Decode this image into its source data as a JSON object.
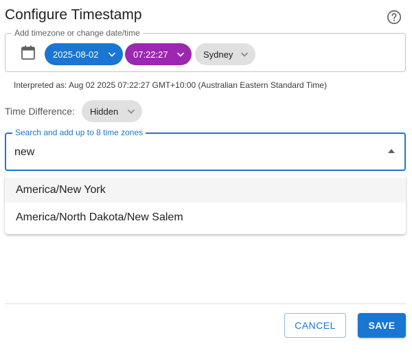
{
  "dialog": {
    "title": "Configure Timestamp",
    "help_icon": "help-circle-icon"
  },
  "timezone_group": {
    "legend": "Add timezone or change date/time",
    "calendar_icon": "calendar-icon",
    "date_chip": "2025-08-02",
    "time_chip": "07:22:27",
    "timezone_chip": "Sydney"
  },
  "interpreted": "Interpreted as: Aug 02 2025 07:22:27 GMT+10:00 (Australian Eastern Standard Time)",
  "time_difference": {
    "label": "Time Difference:",
    "value": "Hidden"
  },
  "search": {
    "legend": "Search and add up to 8 time zones",
    "value": "new"
  },
  "dropdown": {
    "options": [
      "America/New York",
      "America/North Dakota/New Salem"
    ]
  },
  "actions": {
    "cancel": "CANCEL",
    "save": "SAVE"
  },
  "colors": {
    "primary": "#1976d2",
    "time_chip": "#9c27b0",
    "neutral_chip": "#e0e0e0"
  }
}
